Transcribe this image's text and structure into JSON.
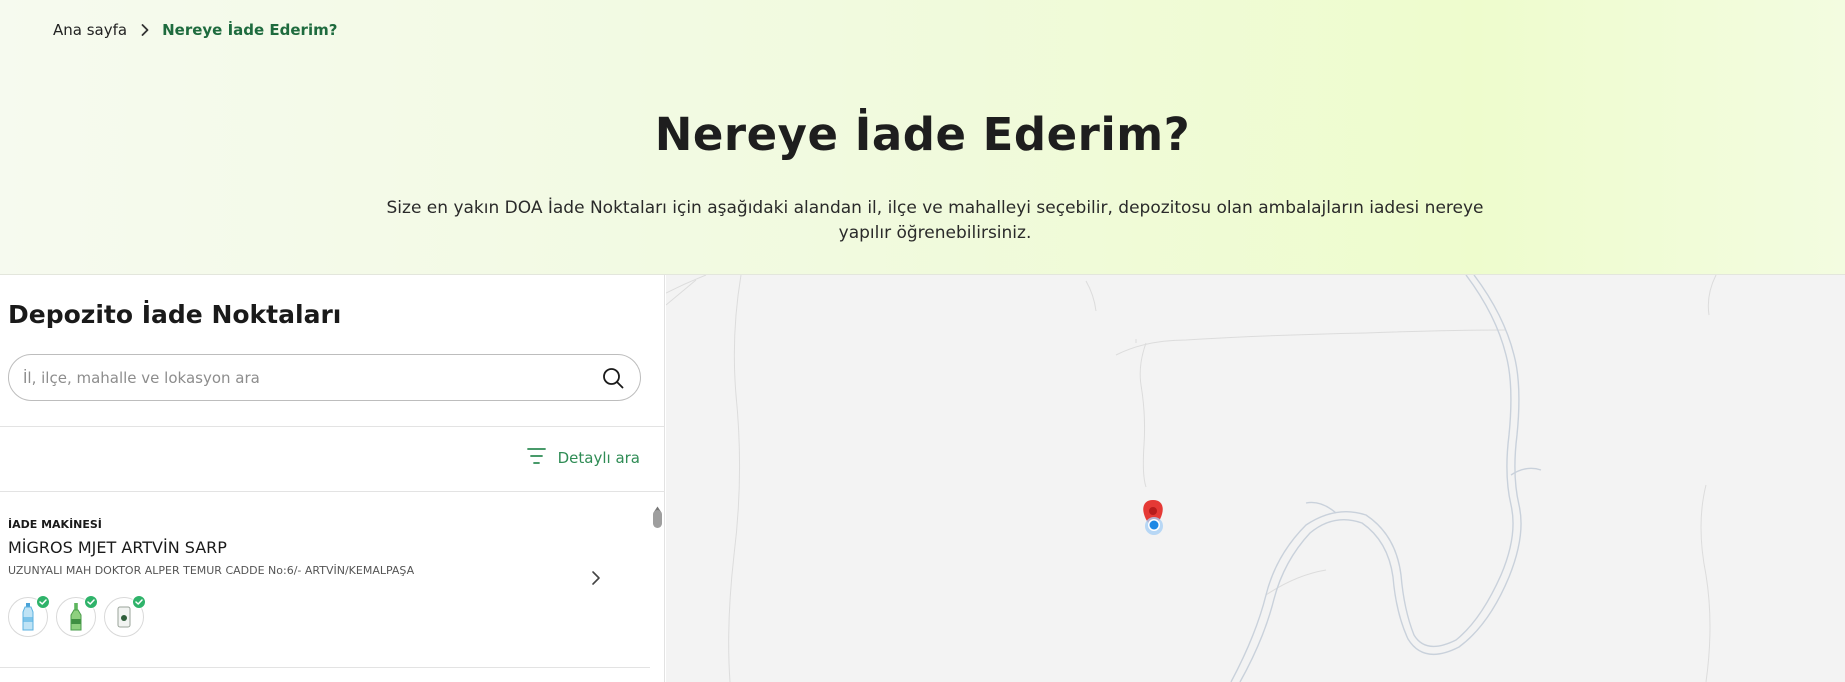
{
  "breadcrumb": {
    "home": "Ana sayfa",
    "current": "Nereye İade Ederim?"
  },
  "hero": {
    "title": "Nereye İade Ederim?",
    "description": "Size en yakın DOA İade Noktaları için aşağıdaki alandan il, ilçe ve mahalleyi seçebilir, depozitosu olan ambalajların iadesi nereye yapılır öğrenebilirsiniz."
  },
  "panel": {
    "title": "Depozito İade Noktaları",
    "search_placeholder": "İl, ilçe, mahalle ve lokasyon ara",
    "filter_label": "Detaylı ara"
  },
  "locations": [
    {
      "type": "İADE MAKİNESİ",
      "name": "MİGROS MJET ARTVİN SARP",
      "address": "UZUNYALI MAH DOKTOR ALPER TEMUR CADDE No:6/- ARTVİN/KEMALPAŞA",
      "accepted": [
        "plastic-bottle-icon",
        "glass-bottle-icon",
        "can-icon"
      ]
    }
  ],
  "colors": {
    "accent": "#2f8c55",
    "breadcrumb_active": "#1e6b3e",
    "check": "#2fb36a",
    "map_marker": "#e53935",
    "location_dot": "#1e88e5"
  },
  "icons": {
    "search": "search-icon",
    "filter": "filter-icon",
    "chevron": "chevron-right-icon",
    "marker": "map-marker-icon"
  }
}
